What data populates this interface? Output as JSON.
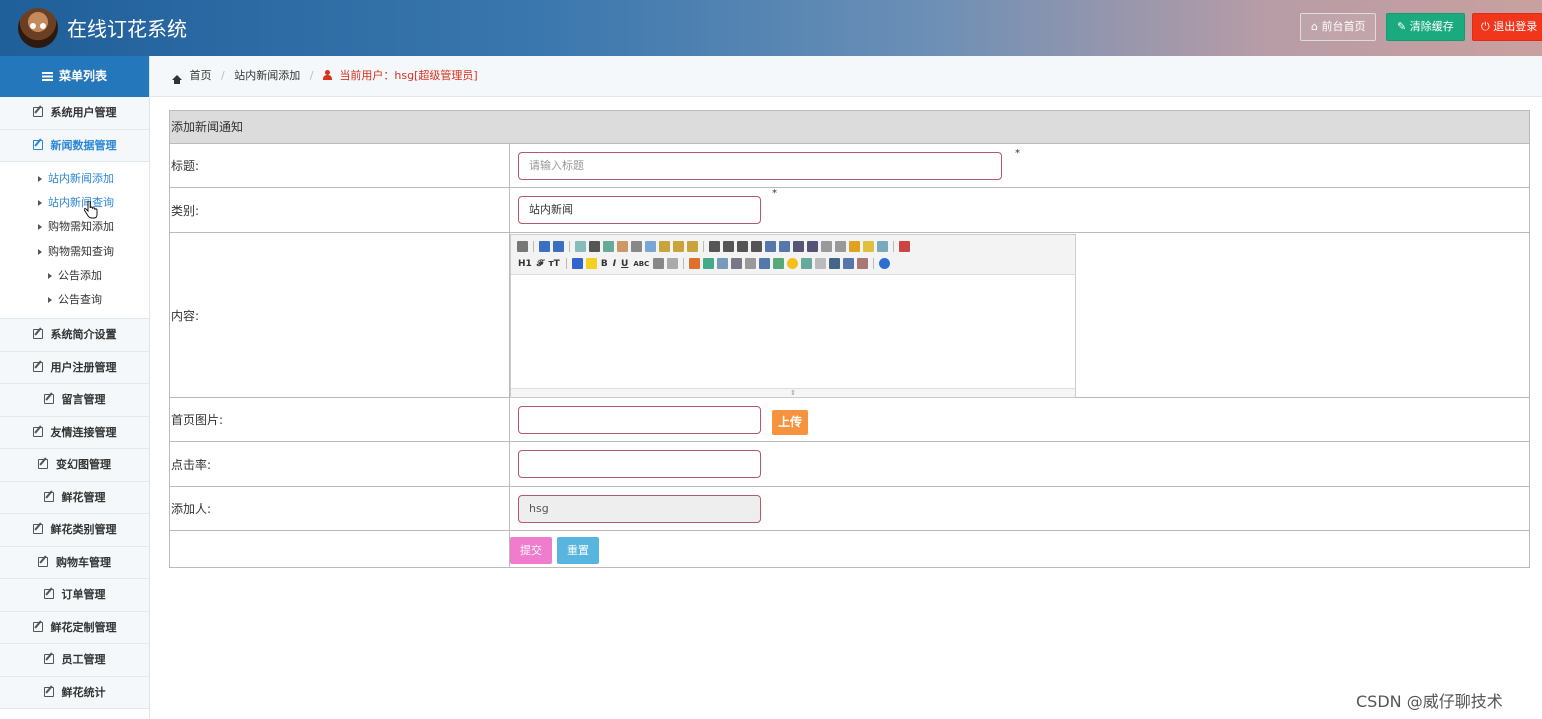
{
  "header": {
    "title": "在线订花系统",
    "front_btn": "前台首页",
    "clear_btn": "清除缓存",
    "logout_btn": "退出登录",
    "colors": {
      "clear": "#1aaa7e",
      "logout": "#f2361c"
    }
  },
  "sidebar": {
    "heading": "菜单列表",
    "items_top": [
      {
        "label": "系统用户管理"
      },
      {
        "label": "新闻数据管理",
        "active": true
      }
    ],
    "sub_items": [
      {
        "label": "站内新闻添加",
        "active": true
      },
      {
        "label": "站内新闻查询",
        "active": true
      },
      {
        "label": "购物需知添加"
      },
      {
        "label": "购物需知查询"
      },
      {
        "label": "公告添加"
      },
      {
        "label": "公告查询"
      }
    ],
    "items_bottom": [
      {
        "label": "系统简介设置"
      },
      {
        "label": "用户注册管理"
      },
      {
        "label": "留言管理"
      },
      {
        "label": "友情连接管理"
      },
      {
        "label": "变幻图管理"
      },
      {
        "label": "鲜花管理"
      },
      {
        "label": "鲜花类别管理"
      },
      {
        "label": "购物车管理"
      },
      {
        "label": "订单管理"
      },
      {
        "label": "鲜花定制管理"
      },
      {
        "label": "员工管理"
      },
      {
        "label": "鲜花统计"
      }
    ]
  },
  "breadcrumb": {
    "home": "首页",
    "page": "站内新闻添加",
    "current_user": "当前用户：hsg[超级管理员]"
  },
  "form": {
    "heading": "添加新闻通知",
    "title_label": "标题:",
    "title_placeholder": "请输入标题",
    "category_label": "类别:",
    "category_value": "站内新闻",
    "content_label": "内容:",
    "image_label": "首页图片:",
    "upload_btn": "上传",
    "clicks_label": "点击率:",
    "author_label": "添加人:",
    "author_value": "hsg",
    "required_mark": "*",
    "submit_btn": "提交",
    "reset_btn": "重置"
  },
  "editor": {
    "toolbar_text": {
      "h1": "H1",
      "font": "𝓕",
      "size": "ᴛT",
      "bold": "B",
      "italic": "I",
      "underline": "U",
      "strike": "ABC"
    }
  },
  "watermark": "CSDN @威仔聊技术"
}
